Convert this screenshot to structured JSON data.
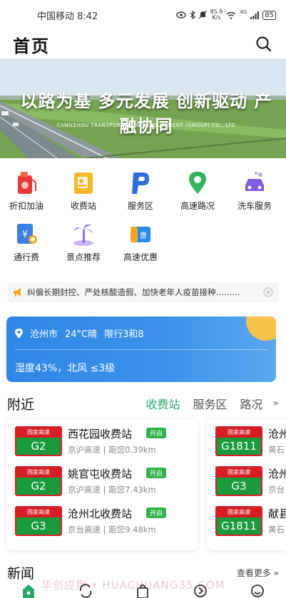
{
  "status_bar": {
    "carrier_time": "中国移动 8:42",
    "net_speed": "85.9\nK/s",
    "signal": "4G",
    "battery": "85"
  },
  "header": {
    "title": "首页"
  },
  "banner": {
    "slogan": "以路为基 多元发展 创新驱动 产融协同",
    "company": "CANGZHOU TRANSPORTATION DEVELOPMENT (GROUP) CO., LTD"
  },
  "services": [
    {
      "label": "折扣加油",
      "icon": "fuel-icon"
    },
    {
      "label": "收费站",
      "icon": "toll-station-icon"
    },
    {
      "label": "服务区",
      "icon": "service-area-icon"
    },
    {
      "label": "高速路况",
      "icon": "road-condition-icon"
    },
    {
      "label": "洗车服务",
      "icon": "car-wash-icon"
    },
    {
      "label": "通行费",
      "icon": "toll-fee-icon"
    },
    {
      "label": "景点推荐",
      "icon": "scenic-spot-icon"
    },
    {
      "label": "高速优惠",
      "icon": "highway-discount-icon"
    }
  ],
  "notice": {
    "text": "纠偏长期封控、严处核酸造假、加快老年人疫苗接种………"
  },
  "weather": {
    "city": "沧州市",
    "condition": "24°C晴",
    "restriction": "限行3和8",
    "detail": "湿度43%，北风 ≤3级"
  },
  "nearby": {
    "title": "附近",
    "tabs": [
      "收费站",
      "服务区",
      "路况"
    ],
    "more": "»",
    "cards": [
      {
        "rows": [
          {
            "badge": "国家高速",
            "code": "G2",
            "name": "西花园收费站",
            "tag": "开启",
            "road": "京沪高速",
            "dist": "距您0.39km"
          },
          {
            "badge": "国家高速",
            "code": "G2",
            "name": "姚官屯收费站",
            "tag": "开启",
            "road": "京沪高速",
            "dist": "距您7.43km"
          },
          {
            "badge": "国家高速",
            "code": "G3",
            "name": "沧州北收费站",
            "tag": "开启",
            "road": "京台高速",
            "dist": "距您9.48km"
          }
        ]
      },
      {
        "rows": [
          {
            "badge": "国家高速",
            "code": "G1811",
            "name": "沧州",
            "road": "黄石"
          },
          {
            "badge": "国家高速",
            "code": "G3",
            "name": "沧州",
            "road": "京台"
          },
          {
            "badge": "国家高速",
            "code": "G1811",
            "name": "献县",
            "road": "黄石"
          }
        ]
      }
    ]
  },
  "news": {
    "title": "新闻",
    "more": "查看更多 »"
  },
  "watermark": "华创应用 • HUACHUANG35.COM",
  "colors": {
    "accent": "#2aa86a",
    "weather": "#2f86e6",
    "badge_red": "#d61f25",
    "badge_green": "#1a9a3c"
  }
}
